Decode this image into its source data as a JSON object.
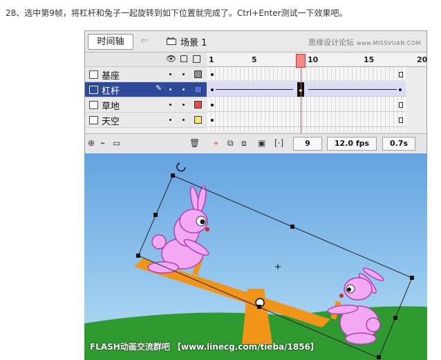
{
  "instruction": "28、选中第9帧，将杠杆和兔子一起旋转到如下位置就完成了。Ctrl+Enter测试一下效果吧。",
  "timeline": {
    "tab_label": "时间轴",
    "scene_label": "场景 1",
    "watermark": "思缘设计论坛",
    "watermark_url": "www.MISSVUAN.COM",
    "ruler_numbers": [
      "1",
      "5",
      "10",
      "15",
      "20"
    ],
    "layers": [
      {
        "name": "基座",
        "color": "#8c8c8c"
      },
      {
        "name": "杠杆",
        "color": "#4f6ee8"
      },
      {
        "name": "草地",
        "color": "#e84848"
      },
      {
        "name": "天空",
        "color": "#f4e870"
      }
    ],
    "current_frame": "9",
    "fps": "12.0 fps",
    "time": "0.7s"
  },
  "stage": {
    "caption": "FLASH动画交流群吧 【www.linecg.com/tieba/1856】",
    "bg_colors": [
      "#64a2e0",
      "#b9def4"
    ],
    "grass_color": "#2f9a2f",
    "plank_color": "#f29418",
    "bunny_color": "#f3a8f3"
  }
}
